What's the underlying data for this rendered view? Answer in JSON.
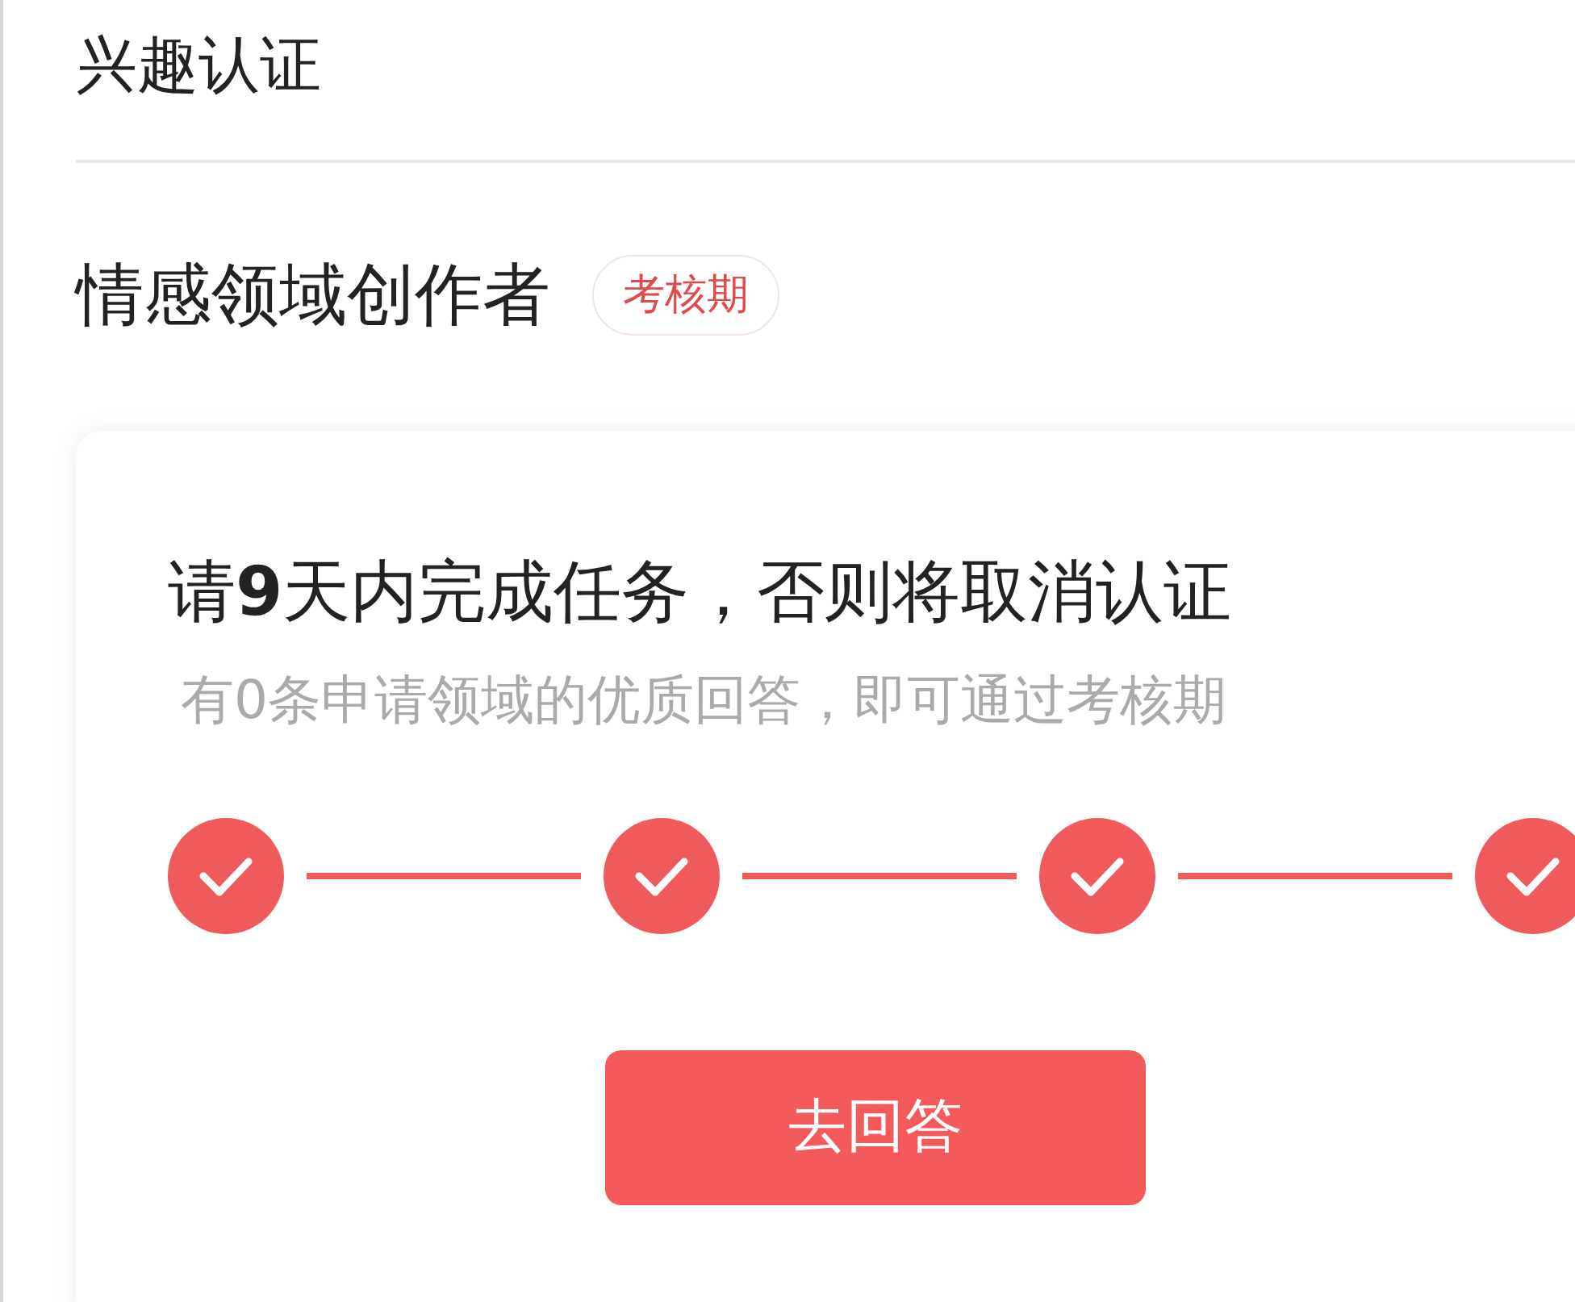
{
  "page": {
    "title": "兴趣认证"
  },
  "certification": {
    "field": "情感领域创作者",
    "badge": "考核期"
  },
  "task_card": {
    "heading": "请**9**天内完成任务，否则将取消认证",
    "subtitle": "有0条申请领域的优质回答，即可通过考核期",
    "steps": [
      {
        "done": true
      },
      {
        "done": true
      },
      {
        "done": true
      },
      {
        "done": true
      }
    ],
    "button": "去回答"
  }
}
